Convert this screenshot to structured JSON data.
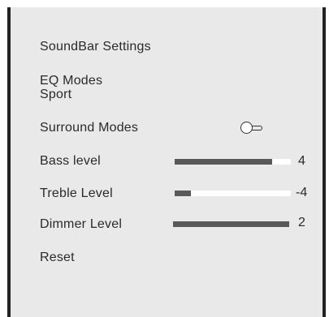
{
  "menu": {
    "title": "SoundBar Settings",
    "eq_modes": {
      "label": "EQ Modes",
      "value": "Sport"
    },
    "surround_modes": {
      "label": "Surround Modes",
      "toggle_state": "off"
    },
    "bass_level": {
      "label": "Bass level",
      "value": "4",
      "fill_fraction": 0.84
    },
    "treble_level": {
      "label": "Treble Level",
      "value": "-4",
      "fill_fraction": 0.14
    },
    "dimmer_level": {
      "label": "Dimmer Level",
      "value": "2",
      "fill_fraction": 1.0
    },
    "reset": {
      "label": "Reset"
    }
  },
  "colors": {
    "panel_background": "#e9e9e9",
    "panel_border": "#222222",
    "slider_fill": "#595959",
    "slider_track": "#ffffff",
    "text": "#2a2a2a"
  }
}
